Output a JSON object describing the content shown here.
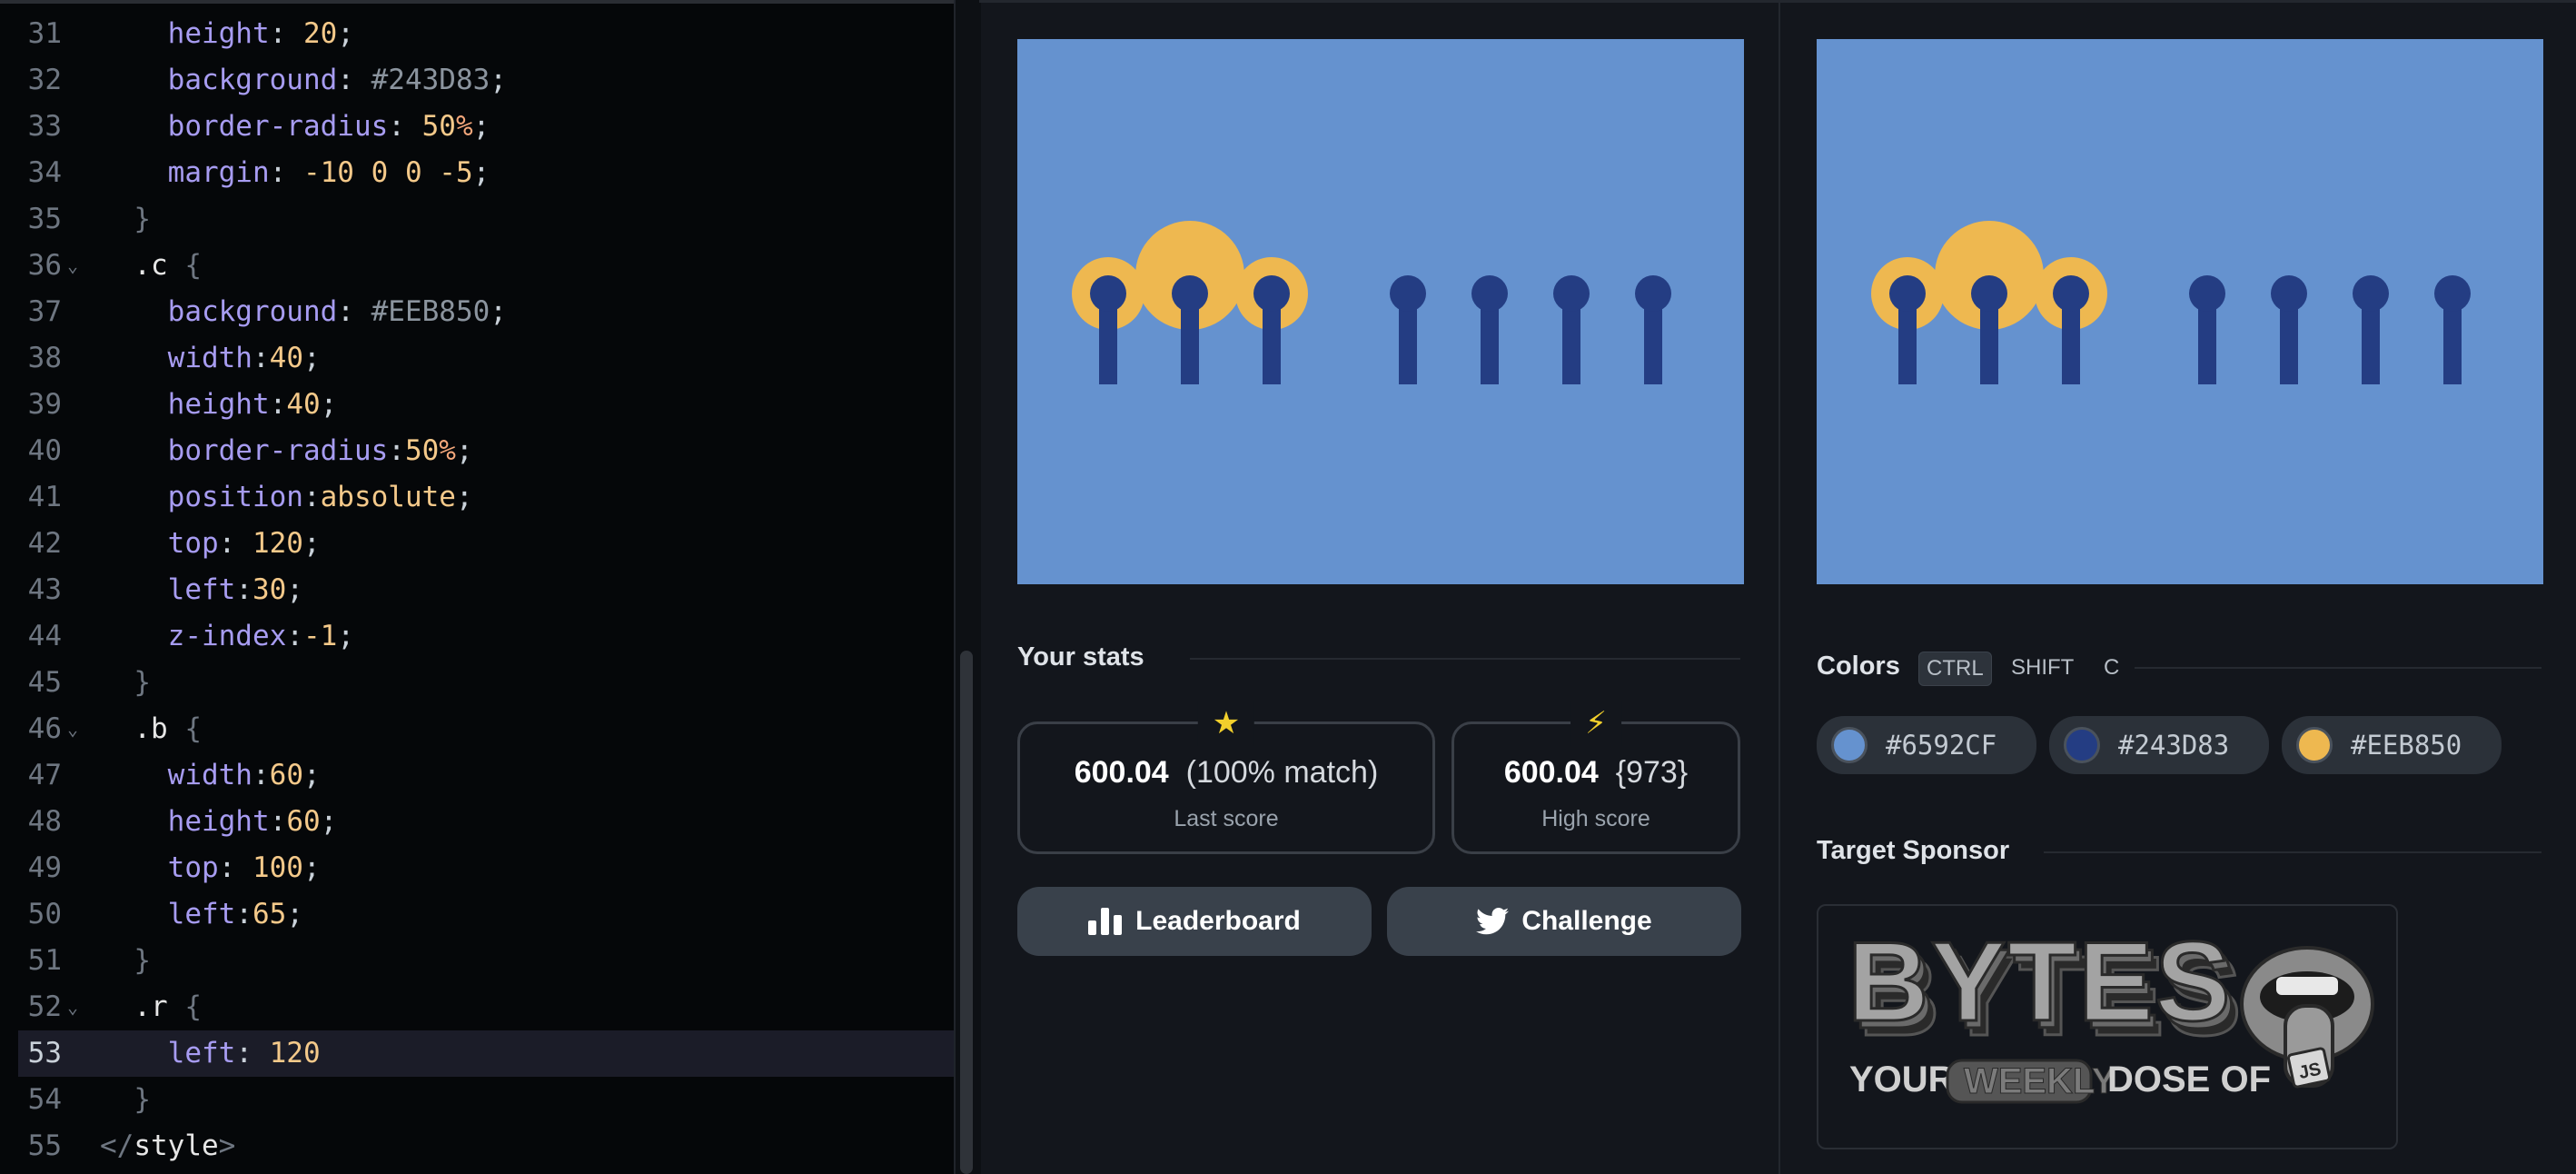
{
  "editor": {
    "lines": [
      {
        "n": "31",
        "fold": false,
        "code": [
          [
            "    ",
            "t-punc"
          ],
          [
            "height",
            "t-prop"
          ],
          [
            ": ",
            "t-punc"
          ],
          [
            "20",
            "t-num"
          ],
          [
            ";",
            "t-punc"
          ]
        ]
      },
      {
        "n": "32",
        "fold": false,
        "code": [
          [
            "    ",
            "t-punc"
          ],
          [
            "background",
            "t-prop"
          ],
          [
            ": ",
            "t-punc"
          ],
          [
            "#243D83",
            "t-hex"
          ],
          [
            ";",
            "t-punc"
          ]
        ]
      },
      {
        "n": "33",
        "fold": false,
        "code": [
          [
            "    ",
            "t-punc"
          ],
          [
            "border-radius",
            "t-prop"
          ],
          [
            ": ",
            "t-punc"
          ],
          [
            "50",
            "t-num"
          ],
          [
            "%",
            "t-unit"
          ],
          [
            ";",
            "t-punc"
          ]
        ]
      },
      {
        "n": "34",
        "fold": false,
        "code": [
          [
            "    ",
            "t-punc"
          ],
          [
            "margin",
            "t-prop"
          ],
          [
            ": ",
            "t-punc"
          ],
          [
            "-10 0 0 -5",
            "t-num"
          ],
          [
            ";",
            "t-punc"
          ]
        ]
      },
      {
        "n": "35",
        "fold": false,
        "code": [
          [
            "  ",
            "t-punc"
          ],
          [
            "}",
            "t-brace"
          ]
        ]
      },
      {
        "n": "36",
        "fold": true,
        "code": [
          [
            "  ",
            "t-punc"
          ],
          [
            ".c",
            "t-sel"
          ],
          [
            " {",
            "t-brace"
          ]
        ]
      },
      {
        "n": "37",
        "fold": false,
        "code": [
          [
            "    ",
            "t-punc"
          ],
          [
            "background",
            "t-prop"
          ],
          [
            ": ",
            "t-punc"
          ],
          [
            "#EEB850",
            "t-hex"
          ],
          [
            ";",
            "t-punc"
          ]
        ]
      },
      {
        "n": "38",
        "fold": false,
        "code": [
          [
            "    ",
            "t-punc"
          ],
          [
            "width",
            "t-prop"
          ],
          [
            ":",
            "t-punc"
          ],
          [
            "40",
            "t-num"
          ],
          [
            ";",
            "t-punc"
          ]
        ]
      },
      {
        "n": "39",
        "fold": false,
        "code": [
          [
            "    ",
            "t-punc"
          ],
          [
            "height",
            "t-prop"
          ],
          [
            ":",
            "t-punc"
          ],
          [
            "40",
            "t-num"
          ],
          [
            ";",
            "t-punc"
          ]
        ]
      },
      {
        "n": "40",
        "fold": false,
        "code": [
          [
            "    ",
            "t-punc"
          ],
          [
            "border-radius",
            "t-prop"
          ],
          [
            ":",
            "t-punc"
          ],
          [
            "50",
            "t-num"
          ],
          [
            "%",
            "t-unit"
          ],
          [
            ";",
            "t-punc"
          ]
        ]
      },
      {
        "n": "41",
        "fold": false,
        "code": [
          [
            "    ",
            "t-punc"
          ],
          [
            "position",
            "t-prop"
          ],
          [
            ":",
            "t-punc"
          ],
          [
            "absolute",
            "t-kw"
          ],
          [
            ";",
            "t-punc"
          ]
        ]
      },
      {
        "n": "42",
        "fold": false,
        "code": [
          [
            "    ",
            "t-punc"
          ],
          [
            "top",
            "t-prop"
          ],
          [
            ": ",
            "t-punc"
          ],
          [
            "120",
            "t-num"
          ],
          [
            ";",
            "t-punc"
          ]
        ]
      },
      {
        "n": "43",
        "fold": false,
        "code": [
          [
            "    ",
            "t-punc"
          ],
          [
            "left",
            "t-prop"
          ],
          [
            ":",
            "t-punc"
          ],
          [
            "30",
            "t-num"
          ],
          [
            ";",
            "t-punc"
          ]
        ]
      },
      {
        "n": "44",
        "fold": false,
        "code": [
          [
            "    ",
            "t-punc"
          ],
          [
            "z-index",
            "t-prop"
          ],
          [
            ":",
            "t-punc"
          ],
          [
            "-1",
            "t-num"
          ],
          [
            ";",
            "t-punc"
          ]
        ]
      },
      {
        "n": "45",
        "fold": false,
        "code": [
          [
            "  ",
            "t-punc"
          ],
          [
            "}",
            "t-brace"
          ]
        ]
      },
      {
        "n": "46",
        "fold": true,
        "code": [
          [
            "  ",
            "t-punc"
          ],
          [
            ".b",
            "t-sel"
          ],
          [
            " {",
            "t-brace"
          ]
        ]
      },
      {
        "n": "47",
        "fold": false,
        "code": [
          [
            "    ",
            "t-punc"
          ],
          [
            "width",
            "t-prop"
          ],
          [
            ":",
            "t-punc"
          ],
          [
            "60",
            "t-num"
          ],
          [
            ";",
            "t-punc"
          ]
        ]
      },
      {
        "n": "48",
        "fold": false,
        "code": [
          [
            "    ",
            "t-punc"
          ],
          [
            "height",
            "t-prop"
          ],
          [
            ":",
            "t-punc"
          ],
          [
            "60",
            "t-num"
          ],
          [
            ";",
            "t-punc"
          ]
        ]
      },
      {
        "n": "49",
        "fold": false,
        "code": [
          [
            "    ",
            "t-punc"
          ],
          [
            "top",
            "t-prop"
          ],
          [
            ": ",
            "t-punc"
          ],
          [
            "100",
            "t-num"
          ],
          [
            ";",
            "t-punc"
          ]
        ]
      },
      {
        "n": "50",
        "fold": false,
        "code": [
          [
            "    ",
            "t-punc"
          ],
          [
            "left",
            "t-prop"
          ],
          [
            ":",
            "t-punc"
          ],
          [
            "65",
            "t-num"
          ],
          [
            ";",
            "t-punc"
          ]
        ]
      },
      {
        "n": "51",
        "fold": false,
        "code": [
          [
            "  ",
            "t-punc"
          ],
          [
            "}",
            "t-brace"
          ]
        ]
      },
      {
        "n": "52",
        "fold": true,
        "code": [
          [
            "  ",
            "t-punc"
          ],
          [
            ".r",
            "t-sel"
          ],
          [
            " {",
            "t-brace"
          ]
        ]
      },
      {
        "n": "53",
        "fold": false,
        "active": true,
        "code": [
          [
            "    ",
            "t-punc"
          ],
          [
            "left",
            "t-prop"
          ],
          [
            ": ",
            "t-punc"
          ],
          [
            "120",
            "t-num"
          ]
        ]
      },
      {
        "n": "54",
        "fold": false,
        "code": [
          [
            "  ",
            "t-punc"
          ],
          [
            "}",
            "t-brace"
          ]
        ]
      },
      {
        "n": "55",
        "fold": false,
        "code": [
          [
            "</",
            "t-brace"
          ],
          [
            "style",
            "t-tag"
          ],
          [
            ">",
            "t-brace"
          ]
        ]
      }
    ],
    "fold_glyph": "⌄"
  },
  "stats": {
    "title": "Your stats",
    "last": {
      "icon": "★",
      "value": "600.04",
      "sub": "(100% match)",
      "label": "Last score"
    },
    "high": {
      "icon": "⚡",
      "value": "600.04",
      "sub": "{973}",
      "label": "High score"
    },
    "leaderboard_label": "Leaderboard",
    "challenge_label": "Challenge"
  },
  "colors": {
    "title": "Colors",
    "shortcut": {
      "ctrl": "CTRL",
      "shift": "SHIFT",
      "key": "C"
    },
    "swatches": [
      {
        "hex": "#6592CF",
        "color": "#6592CF"
      },
      {
        "hex": "#243D83",
        "color": "#243D83"
      },
      {
        "hex": "#EEB850",
        "color": "#EEB850"
      }
    ]
  },
  "sponsor": {
    "title": "Target Sponsor",
    "logo_text": "BYTES",
    "tagline_pre": "YOUR",
    "tagline_mid": "WEEKLY",
    "tagline_post": "DOSE OF",
    "badge": "JS"
  },
  "palette": {
    "bg": "#6592CF",
    "dark": "#243D83",
    "gold": "#EEB850"
  }
}
